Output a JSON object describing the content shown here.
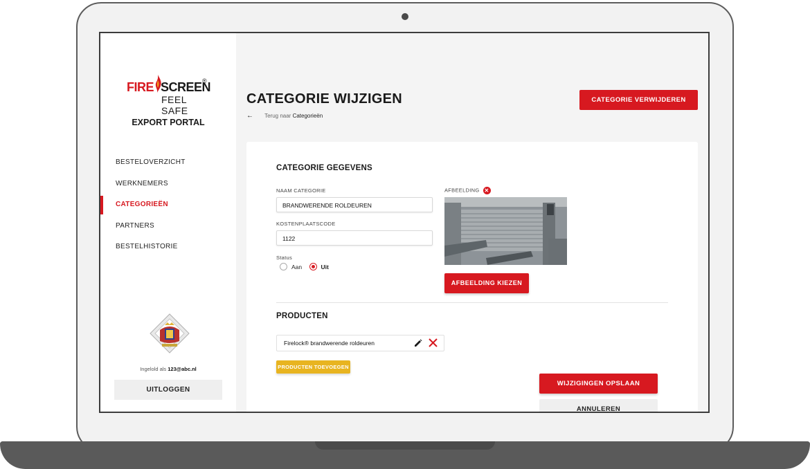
{
  "brand": {
    "logo_top_left": "FIRE",
    "logo_top_right": "SCREEN",
    "logo_registered": "®",
    "logo_tagline": "FEEL SAFE",
    "portal_name": "EXPORT PORTAL",
    "accent_color": "#d71920",
    "secondary_color": "#e8b420"
  },
  "sidebar": {
    "items": [
      {
        "label": "BESTELOVERZICHT",
        "active": false
      },
      {
        "label": "WERKNEMERS",
        "active": false
      },
      {
        "label": "CATEGORIEËN",
        "active": true
      },
      {
        "label": "PARTNERS",
        "active": false
      },
      {
        "label": "BESTELHISTORIE",
        "active": false
      }
    ],
    "logged_in_prefix": "Ingelold als",
    "logged_in_user": "123@abc.nl",
    "logout_label": "UITLOGGEN"
  },
  "header": {
    "title": "CATEGORIE WIJZIGEN",
    "back_prefix": "Terug naar",
    "back_target": "Categorieën",
    "delete_label": "CATEGORIE VERWIJDEREN"
  },
  "form": {
    "section_title": "CATEGORIE GEGEVENS",
    "name_label": "NAAM CATEGORIE",
    "name_value": "BRANDWERENDE ROLDEUREN",
    "code_label": "KOSTENPLAATSCODE",
    "code_value": "1122",
    "status_label": "Status",
    "status_options": [
      "Aan",
      "Uit"
    ],
    "status_selected": "Uit",
    "image_label": "AFBEELDING",
    "image_button": "AFBEELDING KIEZEN"
  },
  "products": {
    "section_title": "PRODUCTEN",
    "items": [
      "Firelock® brandwerende roldeuren"
    ],
    "add_label": "PRODUCTEN TOEVOEGEN"
  },
  "actions": {
    "save_label": "WIJZIGINGEN OPSLAAN",
    "cancel_label": "ANNULEREN"
  }
}
